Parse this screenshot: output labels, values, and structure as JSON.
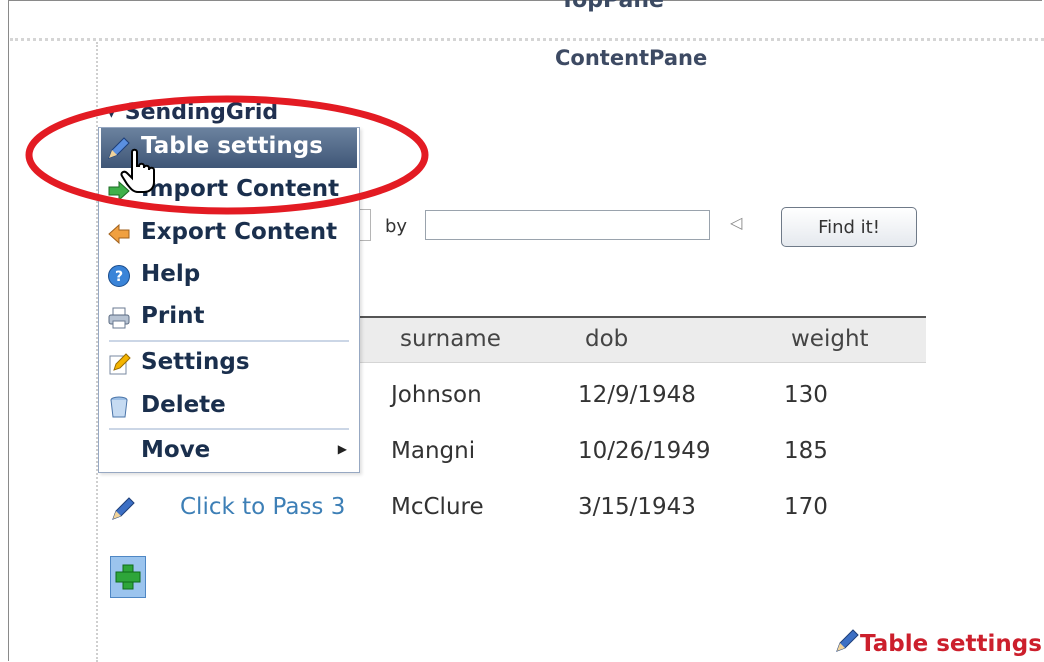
{
  "top_pane_title": "TopPane",
  "pane_title": "ContentPane",
  "module_title": "SendingGrid",
  "context_menu": {
    "items": [
      {
        "label": "Table settings",
        "icon": "pencil-icon"
      },
      {
        "label": "Import Content",
        "icon": "import-arrow-icon"
      },
      {
        "label": "Export Content",
        "icon": "export-arrow-icon"
      },
      {
        "label": "Help",
        "icon": "help-icon"
      },
      {
        "label": "Print",
        "icon": "printer-icon"
      },
      {
        "label": "Settings",
        "icon": "settings-pencil-icon"
      },
      {
        "label": "Delete",
        "icon": "trash-icon"
      },
      {
        "label": "Move",
        "icon": "submenu-arrow-icon"
      }
    ]
  },
  "search": {
    "by_label": "by",
    "value": "",
    "find_label": "Find it!"
  },
  "table": {
    "headers": [
      "surname",
      "dob",
      "weight"
    ],
    "rows": [
      {
        "surname": "Johnson",
        "dob": "12/9/1948",
        "weight": "130"
      },
      {
        "surname": "Mangni",
        "dob": "10/26/1949",
        "weight": "185"
      },
      {
        "link": "Click to Pass 3",
        "surname": "McClure",
        "dob": "3/15/1943",
        "weight": "170"
      }
    ]
  },
  "footer": {
    "settings_label": "Table settings"
  },
  "colors": {
    "accent_red": "#cc1f2c",
    "menu_highlight": "#3f5677",
    "link_blue": "#3d7fb6"
  }
}
